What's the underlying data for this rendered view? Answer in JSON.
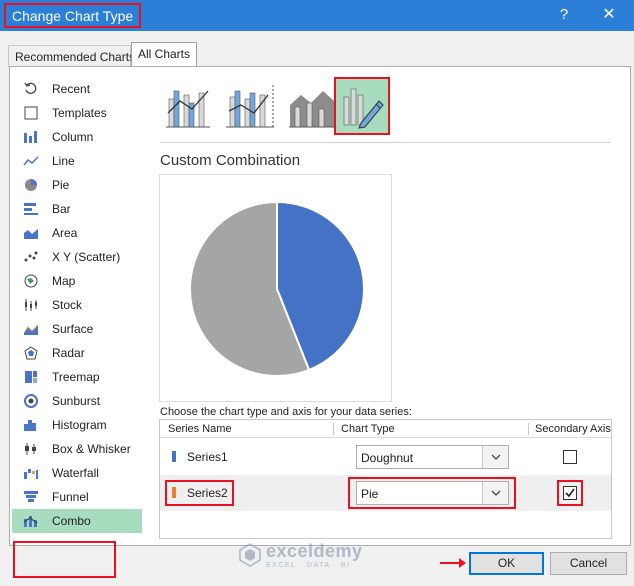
{
  "window": {
    "title": "Change Chart Type",
    "help_label": "?",
    "close_label": "✕"
  },
  "tabs": [
    {
      "label": "Recommended Charts",
      "active": false
    },
    {
      "label": "All Charts",
      "active": true
    }
  ],
  "sidebar": {
    "items": [
      {
        "label": "Recent",
        "icon": "recent-icon"
      },
      {
        "label": "Templates",
        "icon": "templates-icon"
      },
      {
        "label": "Column",
        "icon": "column-chart-icon"
      },
      {
        "label": "Line",
        "icon": "line-chart-icon"
      },
      {
        "label": "Pie",
        "icon": "pie-chart-icon"
      },
      {
        "label": "Bar",
        "icon": "bar-chart-icon"
      },
      {
        "label": "Area",
        "icon": "area-chart-icon"
      },
      {
        "label": "X Y (Scatter)",
        "icon": "scatter-chart-icon"
      },
      {
        "label": "Map",
        "icon": "map-chart-icon"
      },
      {
        "label": "Stock",
        "icon": "stock-chart-icon"
      },
      {
        "label": "Surface",
        "icon": "surface-chart-icon"
      },
      {
        "label": "Radar",
        "icon": "radar-chart-icon"
      },
      {
        "label": "Treemap",
        "icon": "treemap-chart-icon"
      },
      {
        "label": "Sunburst",
        "icon": "sunburst-chart-icon"
      },
      {
        "label": "Histogram",
        "icon": "histogram-chart-icon"
      },
      {
        "label": "Box & Whisker",
        "icon": "box-whisker-chart-icon"
      },
      {
        "label": "Waterfall",
        "icon": "waterfall-chart-icon"
      },
      {
        "label": "Funnel",
        "icon": "funnel-chart-icon"
      },
      {
        "label": "Combo",
        "icon": "combo-chart-icon",
        "selected": true
      }
    ]
  },
  "combo_types": [
    {
      "icon": "clustered-column-line-icon",
      "selected": false
    },
    {
      "icon": "clustered-column-line-secondary-axis-icon",
      "selected": false
    },
    {
      "icon": "stacked-area-clustered-column-icon",
      "selected": false
    },
    {
      "icon": "custom-combination-icon",
      "selected": true
    }
  ],
  "section_title": "Custom Combination",
  "preview": {
    "type": "pie",
    "slices": [
      {
        "series": "Series1",
        "fraction": 0.44,
        "color": "#4472c4"
      },
      {
        "series": "Series2",
        "fraction": 0.56,
        "color": "#a5a5a5"
      }
    ]
  },
  "series_table": {
    "caption": "Choose the chart type and axis for your data series:",
    "headers": {
      "name": "Series Name",
      "type": "Chart Type",
      "axis": "Secondary Axis"
    },
    "rows": [
      {
        "name": "Series1",
        "color": "#4472c4",
        "chart_type": "Doughnut",
        "secondary_axis": false
      },
      {
        "name": "Series2",
        "color": "#ed7d31",
        "chart_type": "Pie",
        "secondary_axis": true
      }
    ]
  },
  "watermark": {
    "name": "exceldemy",
    "tagline": "EXCEL · DATA · BI"
  },
  "buttons": {
    "ok": "OK",
    "cancel": "Cancel"
  },
  "colors": {
    "title_bar": "#2b7fd6",
    "selection": "#a8dcbf",
    "highlight": "#e81123",
    "ok_border": "#0078d7"
  }
}
